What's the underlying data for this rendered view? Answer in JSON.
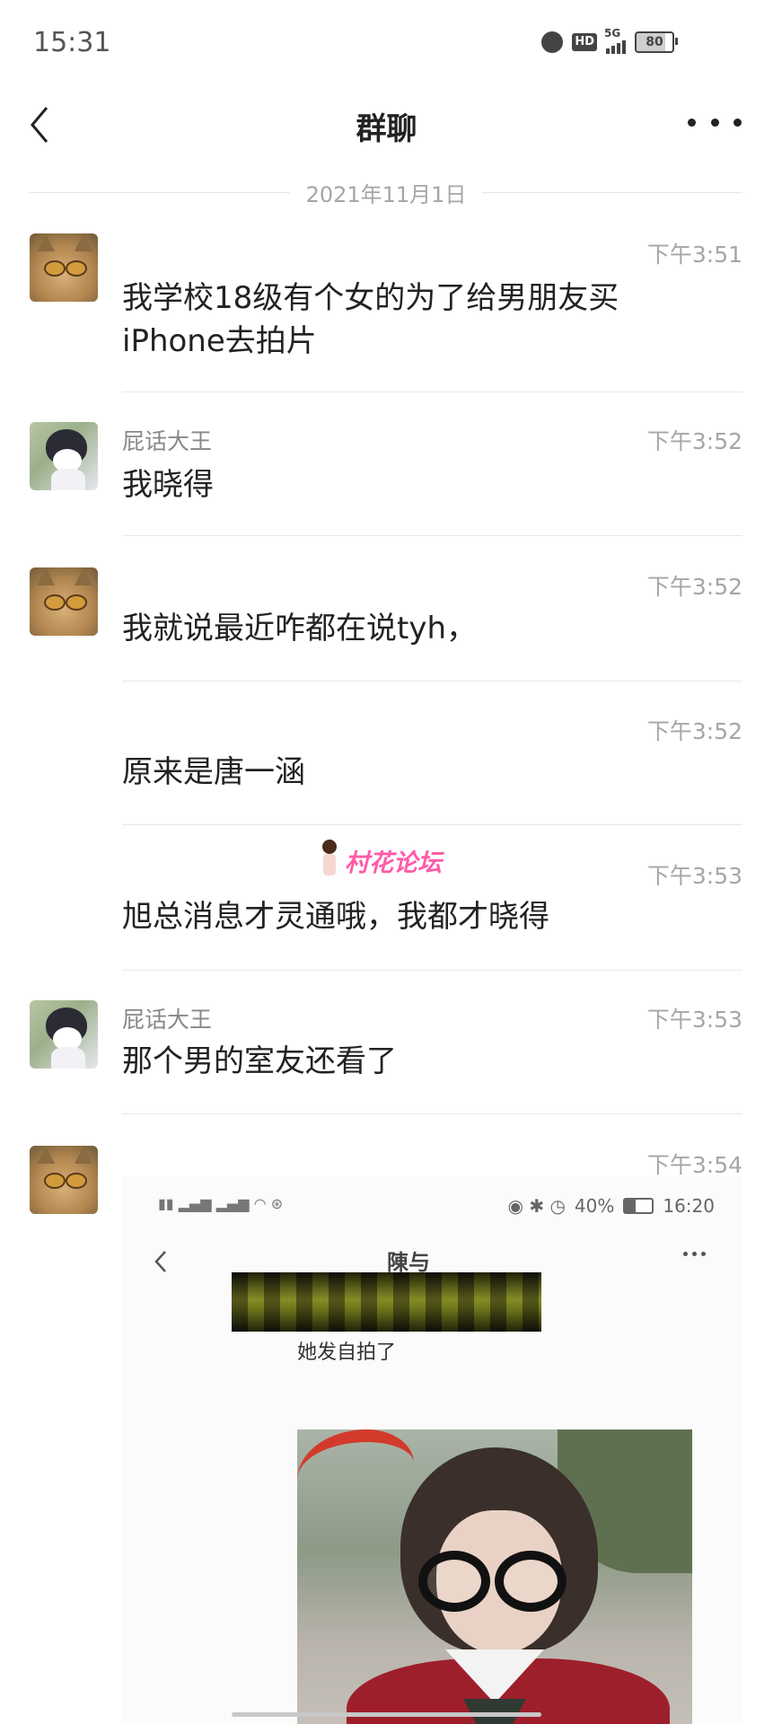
{
  "status_bar": {
    "time": "15:31",
    "network": "5G",
    "hd_badge": "HD",
    "battery": "80",
    "battery_level": 0.8
  },
  "nav": {
    "title": "群聊"
  },
  "date_divider": "2021年11月1日",
  "messages": [
    {
      "avatar": "cat-with-glasses",
      "sender": "",
      "time": "下午3:51",
      "text": "我学校18级有个女的为了给男朋友买iPhone去拍片"
    },
    {
      "avatar": "kuromi",
      "sender": "屁话大王",
      "time": "下午3:52",
      "text": "我晓得"
    },
    {
      "avatar": "cat-with-glasses",
      "sender": "",
      "time": "下午3:52",
      "text": "我就说最近咋都在说tyh，"
    },
    {
      "avatar": "",
      "sender": "",
      "time": "下午3:52",
      "text": "原来是唐一涵"
    },
    {
      "avatar": "",
      "sender": "",
      "time": "下午3:53",
      "text": "旭总消息才灵通哦，我都才晓得"
    },
    {
      "avatar": "kuromi",
      "sender": "屁话大王",
      "time": "下午3:53",
      "text": "那个男的室友还看了"
    },
    {
      "avatar": "cat-with-glasses",
      "sender": "",
      "time": "下午3:54",
      "text": ""
    }
  ],
  "watermark": "村花论坛",
  "shared_image": {
    "status_battery": "40%",
    "status_time": "16:20",
    "title": "陳与",
    "message": "她发自拍了"
  }
}
